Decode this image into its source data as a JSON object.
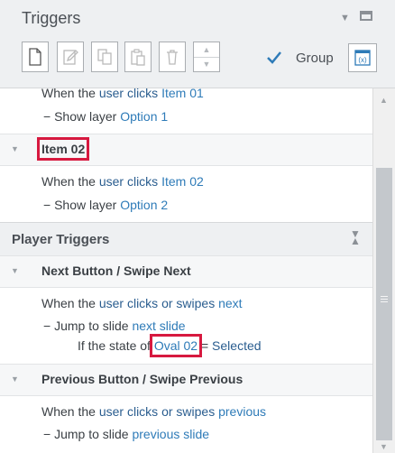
{
  "panel": {
    "title": "Triggers",
    "group_label": "Group",
    "group_checked": true
  },
  "toolbar": {
    "buttons": [
      "new-trigger-icon",
      "edit-trigger-icon",
      "copy-icon",
      "paste-icon",
      "delete-icon",
      "move-up-down-icon"
    ],
    "variables_icon": "variables-icon"
  },
  "slide_triggers": {
    "item01": {
      "line1_prefix": "When the ",
      "line1_keyword": "user clicks",
      "line1_link": "Item 01",
      "action_dash": "−",
      "action_prefix": "Show layer",
      "action_link": "Option 1"
    },
    "item02": {
      "title": "Item 02",
      "line1_prefix": "When the ",
      "line1_keyword": "user clicks",
      "line1_link": "Item 02",
      "action_dash": "−",
      "action_prefix": "Show layer",
      "action_link": "Option 2"
    }
  },
  "player_triggers": {
    "title": "Player Triggers",
    "next": {
      "title": "Next Button / Swipe Next",
      "line1_prefix": "When the ",
      "line1_keyword": "user clicks or swipes",
      "line1_link": "next",
      "action_dash": "−",
      "action_prefix": "Jump to slide",
      "action_link": "next slide",
      "cond_prefix": "If the state of",
      "cond_link": "Oval 02",
      "cond_op": "=",
      "cond_value": "Selected"
    },
    "previous": {
      "title": "Previous Button / Swipe Previous",
      "line1_prefix": "When the ",
      "line1_keyword": "user clicks or swipes",
      "line1_link": "previous",
      "action_dash": "−",
      "action_prefix": "Jump to slide",
      "action_link": "previous slide"
    }
  },
  "colors": {
    "highlight": "#d7193f",
    "link": "#2e7bb8",
    "checkbox": "#2e7bb8"
  }
}
